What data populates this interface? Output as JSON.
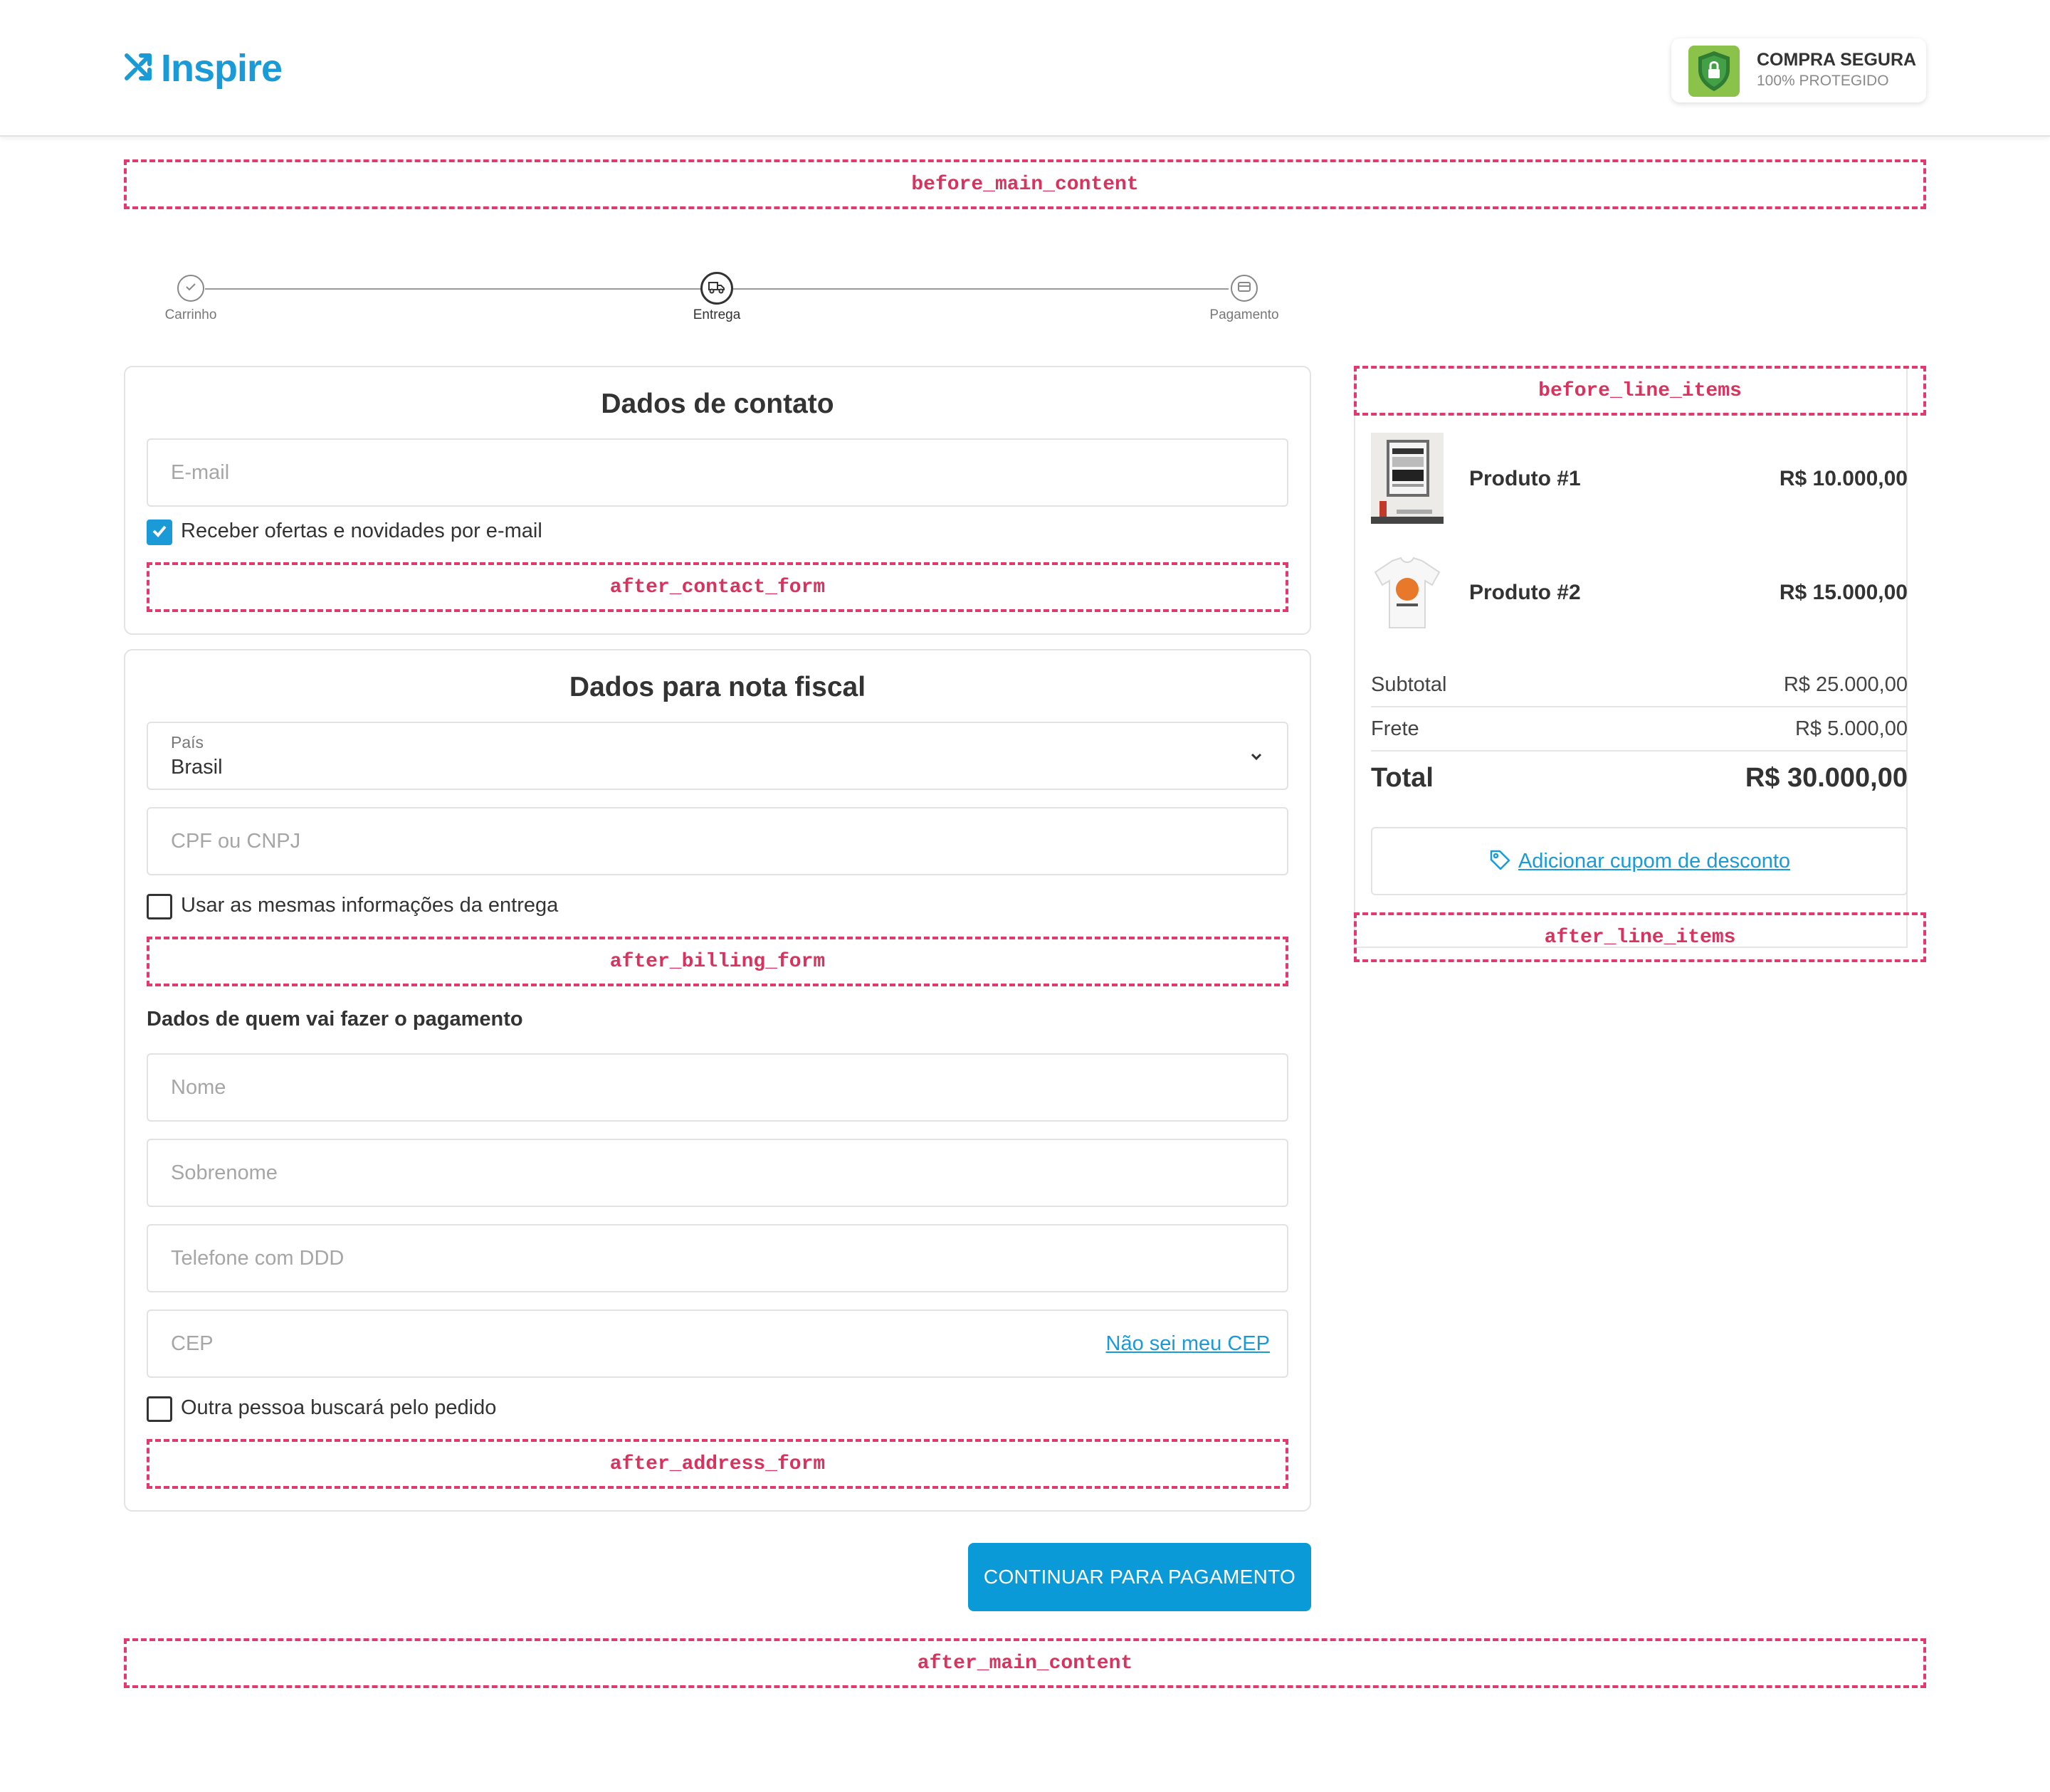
{
  "brand": {
    "name": "Inspire",
    "color": "#1a9ad7"
  },
  "secure_badge": {
    "title": "COMPRA SEGURA",
    "subtitle": "100% PROTEGIDO",
    "icon": "shield-lock-icon"
  },
  "hooks": {
    "before_main_content": "before_main_content",
    "after_contact_form": "after_contact_form",
    "after_billing_form": "after_billing_form",
    "after_address_form": "after_address_form",
    "after_main_content": "after_main_content",
    "before_line_items": "before_line_items",
    "after_line_items": "after_line_items",
    "color": "#e03a6e"
  },
  "stepper": {
    "steps": [
      {
        "label": "Carrinho",
        "icon": "check-icon",
        "state": "done"
      },
      {
        "label": "Entrega",
        "icon": "truck-icon",
        "state": "active"
      },
      {
        "label": "Pagamento",
        "icon": "card-icon",
        "state": "upcoming"
      }
    ]
  },
  "contact": {
    "title": "Dados de contato",
    "email_placeholder": "E-mail",
    "offers_label": "Receber ofertas e novidades por e-mail",
    "offers_checked": true
  },
  "billing": {
    "title": "Dados para nota fiscal",
    "country_label": "País",
    "country_value": "Brasil",
    "document_placeholder": "CPF ou CNPJ",
    "same_as_shipping_label": "Usar as mesmas informações da entrega",
    "payer_heading": "Dados de quem vai fazer o pagamento",
    "first_name_placeholder": "Nome",
    "last_name_placeholder": "Sobrenome",
    "phone_placeholder": "Telefone com DDD",
    "cep_placeholder": "CEP",
    "cep_help_link": "Não sei meu CEP",
    "pickup_other_label": "Outra pessoa buscará pelo pedido"
  },
  "continue_button": "CONTINUAR PARA PAGAMENTO",
  "summary": {
    "items": [
      {
        "name": "Produto #1",
        "price": "R$ 10.000,00",
        "image": "poster-frame-thumbnail"
      },
      {
        "name": "Produto #2",
        "price": "R$ 15.000,00",
        "image": "tshirt-thumbnail"
      }
    ],
    "subtotal_label": "Subtotal",
    "subtotal_value": "R$ 25.000,00",
    "shipping_label": "Frete",
    "shipping_value": "R$ 5.000,00",
    "total_label": "Total",
    "total_value": "R$ 30.000,00",
    "coupon_link": "Adicionar cupom de desconto"
  }
}
